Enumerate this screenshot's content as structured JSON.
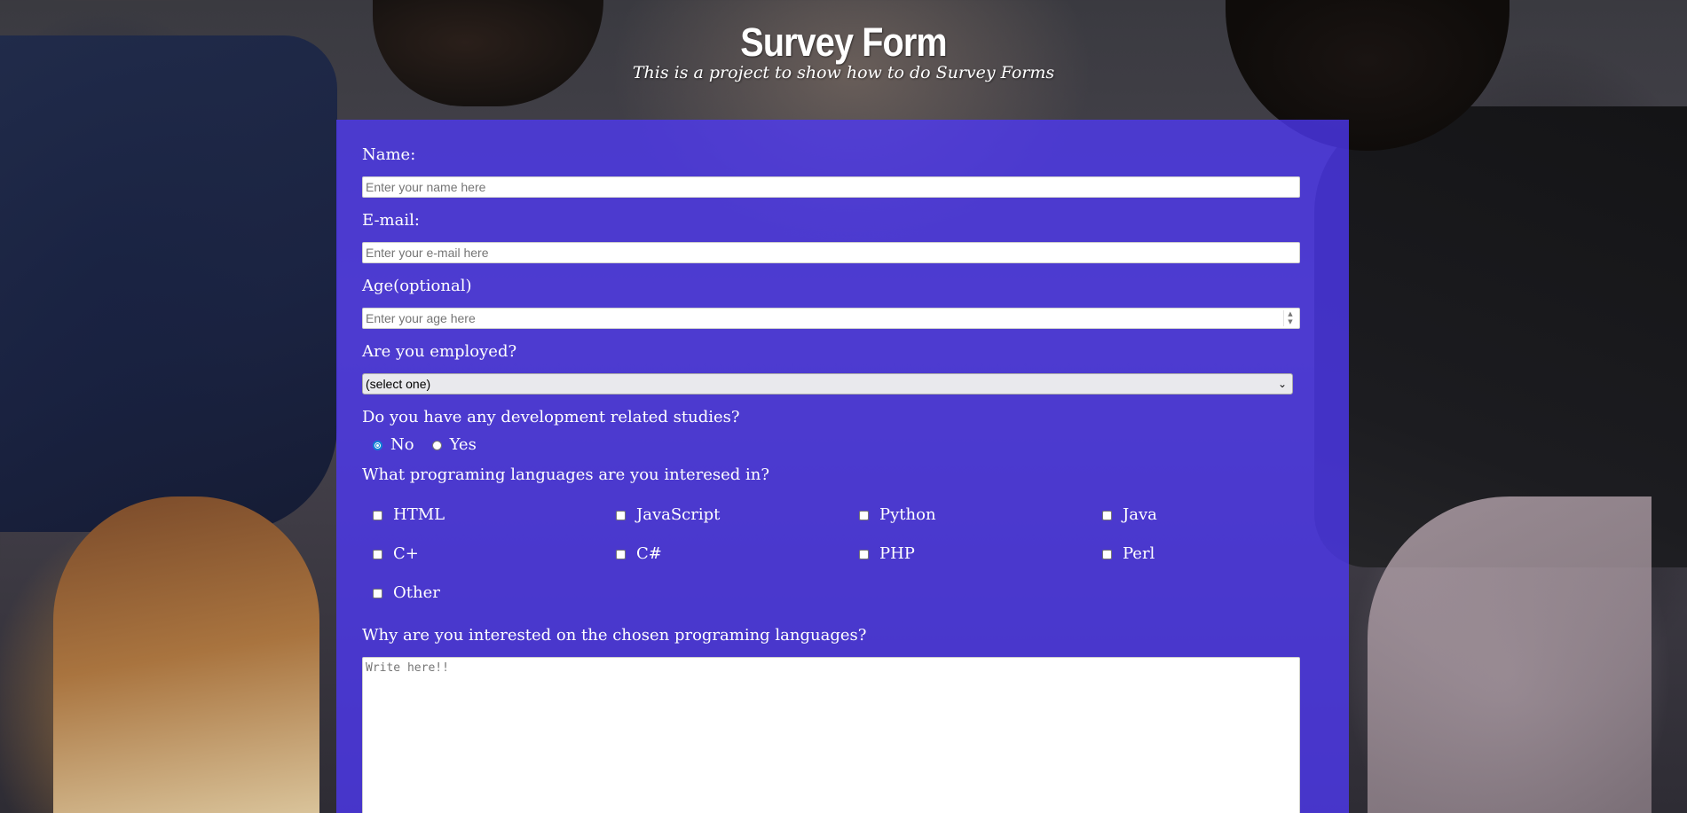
{
  "header": {
    "title": "Survey Form",
    "subtitle": "This is a project to show how to do Survey Forms"
  },
  "form": {
    "name": {
      "label": "Name:",
      "placeholder": "Enter your name here",
      "value": ""
    },
    "email": {
      "label": "E-mail:",
      "placeholder": "Enter your e-mail here",
      "value": ""
    },
    "age": {
      "label": "Age(optional)",
      "placeholder": "Enter your age here",
      "value": ""
    },
    "employed": {
      "label": "Are you employed?",
      "selected": "(select one)"
    },
    "studies": {
      "label": "Do you have any development related studies?",
      "options": [
        {
          "label": "No",
          "checked": true
        },
        {
          "label": "Yes",
          "checked": false
        }
      ]
    },
    "languages": {
      "label": "What programing languages are you interesed in?",
      "options": [
        {
          "label": "HTML",
          "checked": false
        },
        {
          "label": "JavaScript",
          "checked": false
        },
        {
          "label": "Python",
          "checked": false
        },
        {
          "label": "Java",
          "checked": false
        },
        {
          "label": "C+",
          "checked": false
        },
        {
          "label": "C#",
          "checked": false
        },
        {
          "label": "PHP",
          "checked": false
        },
        {
          "label": "Perl",
          "checked": false
        },
        {
          "label": "Other",
          "checked": false
        }
      ]
    },
    "reason": {
      "label": "Why are you interested on the chosen programing languages?",
      "placeholder": "Write here!!",
      "value": ""
    }
  },
  "colors": {
    "panel": "#4e38f5",
    "text": "#ffffff"
  }
}
